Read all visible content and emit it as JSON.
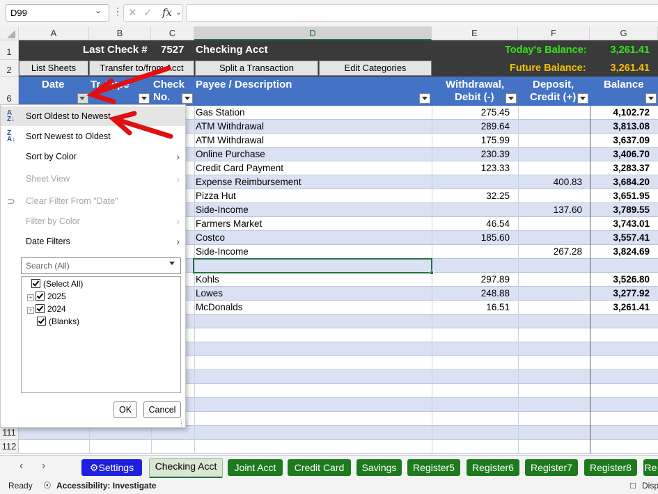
{
  "formula_bar": {
    "name_box": "D99",
    "fx": "fx",
    "formula": ""
  },
  "columns": [
    "A",
    "B",
    "C",
    "D",
    "E",
    "F",
    "G"
  ],
  "rows": {
    "r1": "1",
    "r2": "2",
    "r6": "6",
    "r111": "111",
    "r112": "112"
  },
  "header": {
    "last_check_label": "Last Check #",
    "last_check_value": "7527",
    "account_name": "Checking Acct",
    "todays_balance_label": "Today's Balance:",
    "todays_balance_value": "3,261.41",
    "future_balance_label": "Future Balance:",
    "future_balance_value": "3,261.41",
    "buttons": [
      "List Sheets",
      "Transfer to/from Acct",
      "Split a Transaction",
      "Edit Categories"
    ]
  },
  "table_headers": {
    "date": "Date",
    "type": "Tr. Type",
    "check_1": "Check",
    "check_2": "No.",
    "payee": "Payee / Description",
    "withdrawal_1": "Withdrawal,",
    "withdrawal_2": "Debit (-)",
    "deposit_1": "Deposit,",
    "deposit_2": "Credit (+)",
    "balance": "Balance"
  },
  "transactions": [
    {
      "payee": "Gas Station",
      "withdrawal": "275.45",
      "deposit": "",
      "balance": "4,102.72"
    },
    {
      "payee": "ATM Withdrawal",
      "withdrawal": "289.64",
      "deposit": "",
      "balance": "3,813.08"
    },
    {
      "payee": "ATM Withdrawal",
      "withdrawal": "175.99",
      "deposit": "",
      "balance": "3,637.09"
    },
    {
      "payee": "Online Purchase",
      "withdrawal": "230.39",
      "deposit": "",
      "balance": "3,406.70"
    },
    {
      "payee": "Credit Card Payment",
      "withdrawal": "123.33",
      "deposit": "",
      "balance": "3,283.37"
    },
    {
      "payee": "Expense Reimbursement",
      "withdrawal": "",
      "deposit": "400.83",
      "balance": "3,684.20"
    },
    {
      "payee": "Pizza Hut",
      "withdrawal": "32.25",
      "deposit": "",
      "balance": "3,651.95"
    },
    {
      "payee": "Side-Income",
      "withdrawal": "",
      "deposit": "137.60",
      "balance": "3,789.55"
    },
    {
      "payee": "Farmers Market",
      "withdrawal": "46.54",
      "deposit": "",
      "balance": "3,743.01"
    },
    {
      "payee": "Costco",
      "withdrawal": "185.60",
      "deposit": "",
      "balance": "3,557.41"
    },
    {
      "payee": "Side-Income",
      "withdrawal": "",
      "deposit": "267.28",
      "balance": "3,824.69"
    },
    {
      "payee": "",
      "withdrawal": "",
      "deposit": "",
      "balance": ""
    },
    {
      "payee": "Kohls",
      "withdrawal": "297.89",
      "deposit": "",
      "balance": "3,526.80"
    },
    {
      "payee": "Lowes",
      "withdrawal": "248.88",
      "deposit": "",
      "balance": "3,277.92"
    },
    {
      "payee": "McDonalds",
      "withdrawal": "16.51",
      "deposit": "",
      "balance": "3,261.41"
    }
  ],
  "filter_menu": {
    "items": [
      {
        "label": "Sort Oldest to Newest",
        "icon": "sort-ascending-icon"
      },
      {
        "label": "Sort Newest to Oldest",
        "icon": "sort-descending-icon"
      },
      {
        "label": "Sort by Color"
      },
      {
        "label": "Sheet View"
      },
      {
        "label": "Clear Filter From \"Date\"",
        "icon": "clear-filter-icon"
      },
      {
        "label": "Filter by Color"
      },
      {
        "label": "Date Filters"
      }
    ],
    "search_placeholder": "Search (All)",
    "tree": [
      "(Select All)",
      "2025",
      "2024",
      "(Blanks)"
    ],
    "ok": "OK",
    "cancel": "Cancel"
  },
  "sheet_tabs": [
    "Settings",
    "Checking Acct",
    "Joint Acct",
    "Credit Card",
    "Savings",
    "Register5",
    "Register6",
    "Register7",
    "Register8",
    "Re"
  ],
  "status": {
    "ready": "Ready",
    "accessibility": "Accessibility: Investigate",
    "display": "Disp"
  },
  "colors": {
    "table_header": "#4472c4",
    "band": "#d9e1f2",
    "tab_green": "#1e7a1e",
    "tab_blue": "#1f1fe0",
    "annotation_arrow": "#e01010"
  }
}
